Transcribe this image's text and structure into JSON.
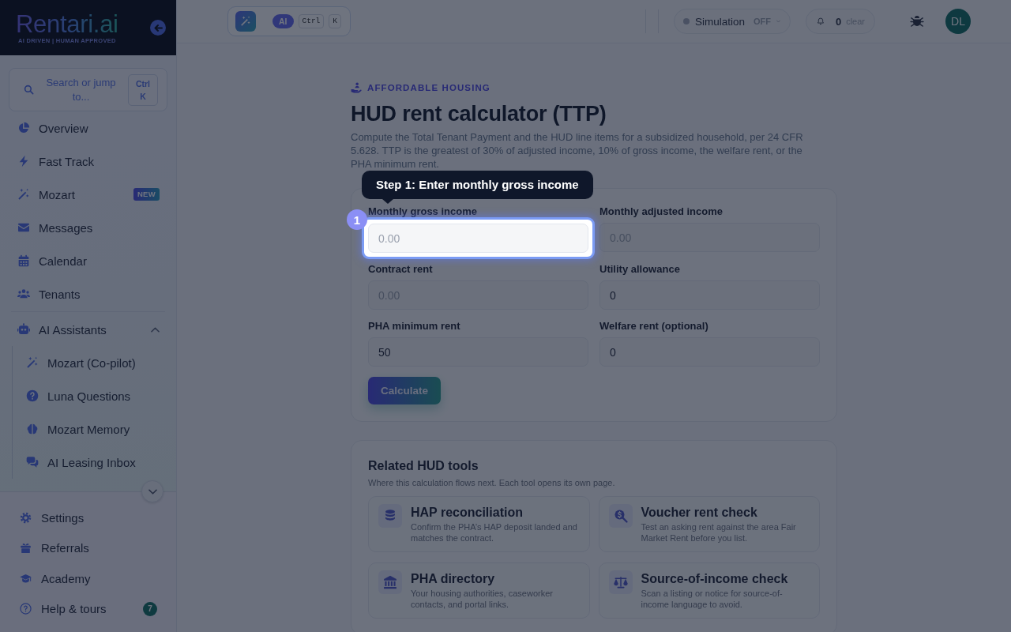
{
  "sidebar": {
    "logo": "Rentari.ai",
    "tagline": "AI DRIVEN | HUMAN APPROVED",
    "search": {
      "label": "Search or jump to...",
      "shortcut": "Ctrl K"
    },
    "nav": [
      {
        "label": "Overview"
      },
      {
        "label": "Fast Track"
      },
      {
        "label": "Mozart",
        "badge": "NEW"
      },
      {
        "label": "Messages"
      },
      {
        "label": "Calendar"
      },
      {
        "label": "Tenants"
      }
    ],
    "group": {
      "label": "AI Assistants",
      "expanded": true,
      "children": [
        {
          "label": "Mozart (Co-pilot)"
        },
        {
          "label": "Luna Questions"
        },
        {
          "label": "Mozart Memory"
        },
        {
          "label": "AI Leasing Inbox"
        }
      ]
    },
    "footer": [
      {
        "label": "Settings"
      },
      {
        "label": "Referrals"
      },
      {
        "label": "Academy"
      },
      {
        "label": "Help & tours",
        "badge": "7"
      }
    ]
  },
  "topbar": {
    "ai_launcher": {
      "badge": "AI",
      "keys": [
        "Ctrl",
        "K"
      ]
    },
    "simulation": {
      "label": "Simulation",
      "state": "OFF"
    },
    "notifications": {
      "count": "0",
      "action": "clear"
    },
    "avatar": "DL"
  },
  "page": {
    "eyebrow": "AFFORDABLE HOUSING",
    "title": "HUD rent calculator (TTP)",
    "description": "Compute the Total Tenant Payment and the HUD line items for a subsidized household, per 24 CFR 5.628. TTP is the greatest of 30% of adjusted income, 10% of gross income, the welfare rent, or the PHA minimum rent."
  },
  "form": {
    "fields": [
      {
        "label": "Monthly gross income",
        "placeholder": "0.00",
        "highlighted": true
      },
      {
        "label": "Monthly adjusted income",
        "placeholder": "0.00",
        "highlighted": false
      },
      {
        "label": "Contract rent",
        "placeholder": "0.00",
        "highlighted": false
      },
      {
        "label": "Utility allowance",
        "value": "0",
        "highlighted": false
      },
      {
        "label": "PHA minimum rent",
        "value": "50",
        "highlighted": false
      },
      {
        "label": "Welfare rent (optional)",
        "value": "0",
        "highlighted": false
      }
    ],
    "submit": "Calculate"
  },
  "tour": {
    "step": "1",
    "text": "Step 1: Enter monthly gross income"
  },
  "related": {
    "title": "Related HUD tools",
    "subtitle": "Where this calculation flows next. Each tool opens its own page.",
    "tools": [
      {
        "title": "HAP reconciliation",
        "description": "Confirm the PHA’s HAP deposit landed and matches the contract."
      },
      {
        "title": "Voucher rent check",
        "description": "Test an asking rent against the area Fair Market Rent before you list."
      },
      {
        "title": "PHA directory",
        "description": "Your housing authorities, caseworker contacts, and portal links."
      },
      {
        "title": "Source-of-income check",
        "description": "Scan a listing or notice for source-of-income language to avoid."
      }
    ]
  }
}
